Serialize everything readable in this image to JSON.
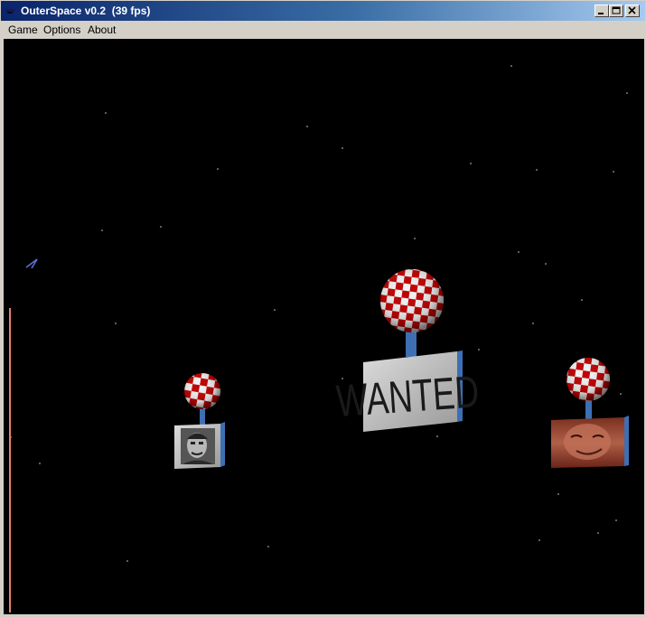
{
  "window": {
    "title": "OuterSpace v0.2  (39 fps)"
  },
  "menu": {
    "items": [
      "Game",
      "Options",
      "About"
    ]
  },
  "scene": {
    "signs": [
      {
        "kind": "portrait",
        "label": ""
      },
      {
        "kind": "text",
        "label": "WANTED"
      },
      {
        "kind": "portrait",
        "label": ""
      }
    ]
  },
  "colors": {
    "checker_red": "#c00000",
    "checker_white": "#f2f2f2",
    "pole": "#3d6fb2",
    "health_bar": "#e88070",
    "space": "#000000"
  }
}
